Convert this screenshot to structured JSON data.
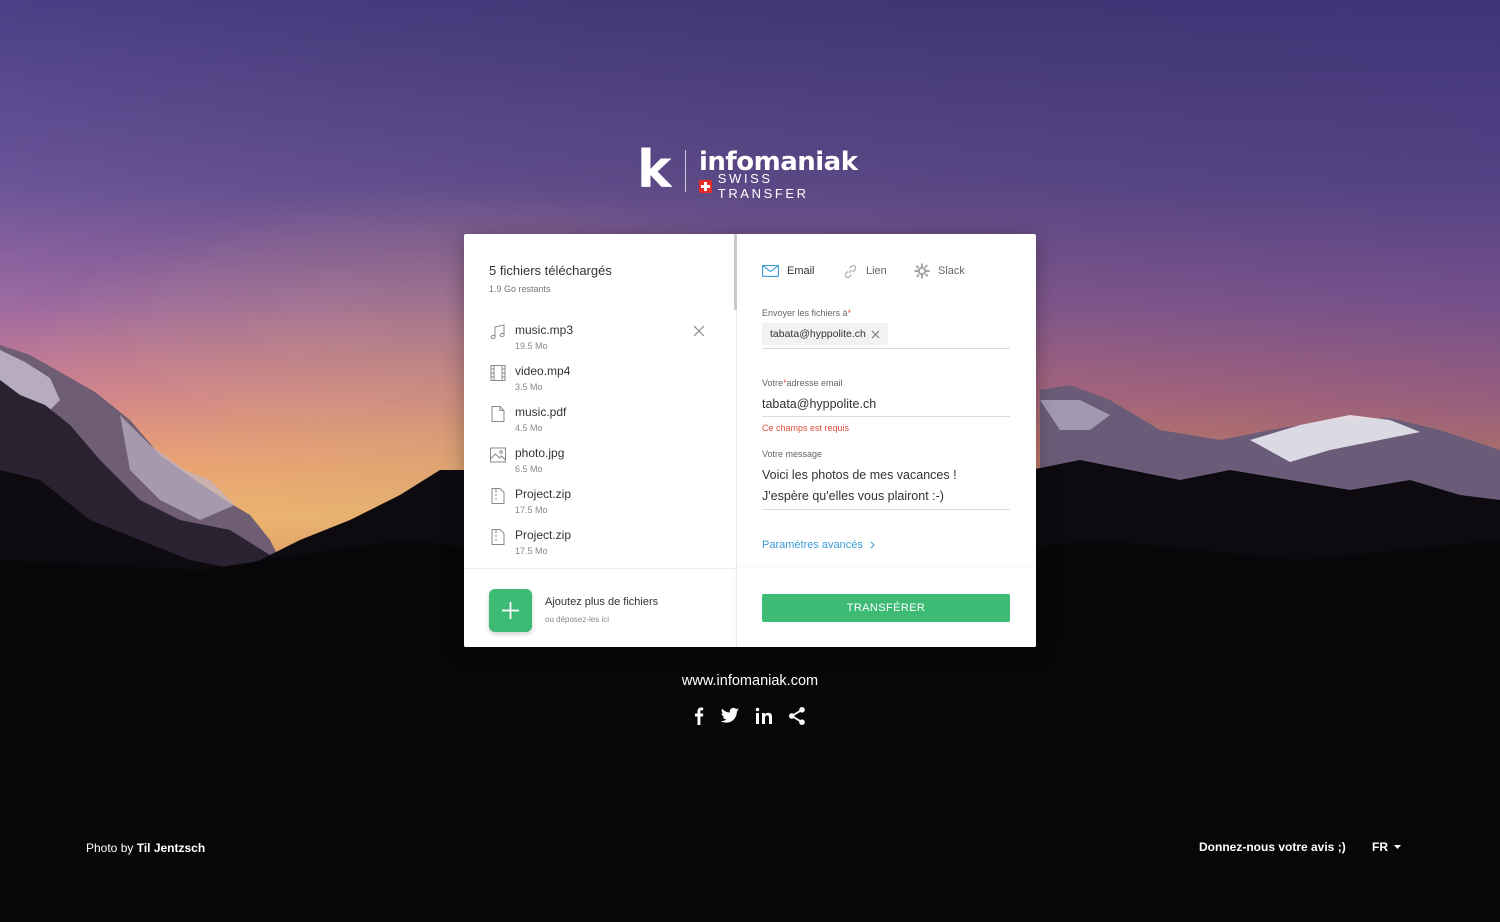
{
  "brand": {
    "logo_letter": "k",
    "name": "infomaniak",
    "tagline": "SWISS TRANSFER"
  },
  "files": {
    "title": "5 fichiers téléchargés",
    "remaining": "1.9 Go restants",
    "items": [
      {
        "name": "music.mp3",
        "size": "19.5 Mo",
        "icon": "music-file-icon"
      },
      {
        "name": "video.mp4",
        "size": "3.5 Mo",
        "icon": "video-file-icon"
      },
      {
        "name": "music.pdf",
        "size": "4.5 Mo",
        "icon": "document-file-icon"
      },
      {
        "name": "photo.jpg",
        "size": "6.5 Mo",
        "icon": "image-file-icon"
      },
      {
        "name": "Project.zip",
        "size": "17.5 Mo",
        "icon": "archive-file-icon"
      },
      {
        "name": "Project.zip",
        "size": "17.5 Mo",
        "icon": "archive-file-icon"
      }
    ],
    "add_label": "Ajoutez plus de fichiers",
    "add_hint": "ou déposez-les ici"
  },
  "tabs": [
    {
      "label": "Email",
      "icon": "envelope-icon",
      "active": true
    },
    {
      "label": "Lien",
      "icon": "link-icon",
      "active": false
    },
    {
      "label": "Slack",
      "icon": "slack-icon",
      "active": false
    }
  ],
  "form": {
    "recipients_label": "Envoyer les fichiers à",
    "required_mark": "*",
    "recipient_chip": "tabata@hyppolite.ch",
    "sender_label_before": "Votre",
    "sender_label_after": "adresse email",
    "sender_value": "tabata@hyppolite.ch",
    "sender_error": "Ce champs est requis",
    "message_label": "Votre message",
    "message_line1": "Voici les photos de mes vacances !",
    "message_line2": "J'espère qu'elles vous plairont :-)",
    "advanced_label": "Paramètres avancés",
    "submit_label": "TRANSFÉRER"
  },
  "footer": {
    "site_url": "www.infomaniak.com",
    "social": [
      "facebook-icon",
      "twitter-icon",
      "linkedin-icon",
      "share-icon"
    ],
    "credit_prefix": "Photo by",
    "credit_name": "Til Jentzsch",
    "feedback": "Donnez-nous votre avis ;)",
    "language": "FR"
  },
  "colors": {
    "accent_green": "#3dbb74",
    "link_blue": "#3b9bd9",
    "error_red": "#e14f3f",
    "sky_top": "#4a3f85",
    "sky_horizon": "#f09a5a"
  }
}
